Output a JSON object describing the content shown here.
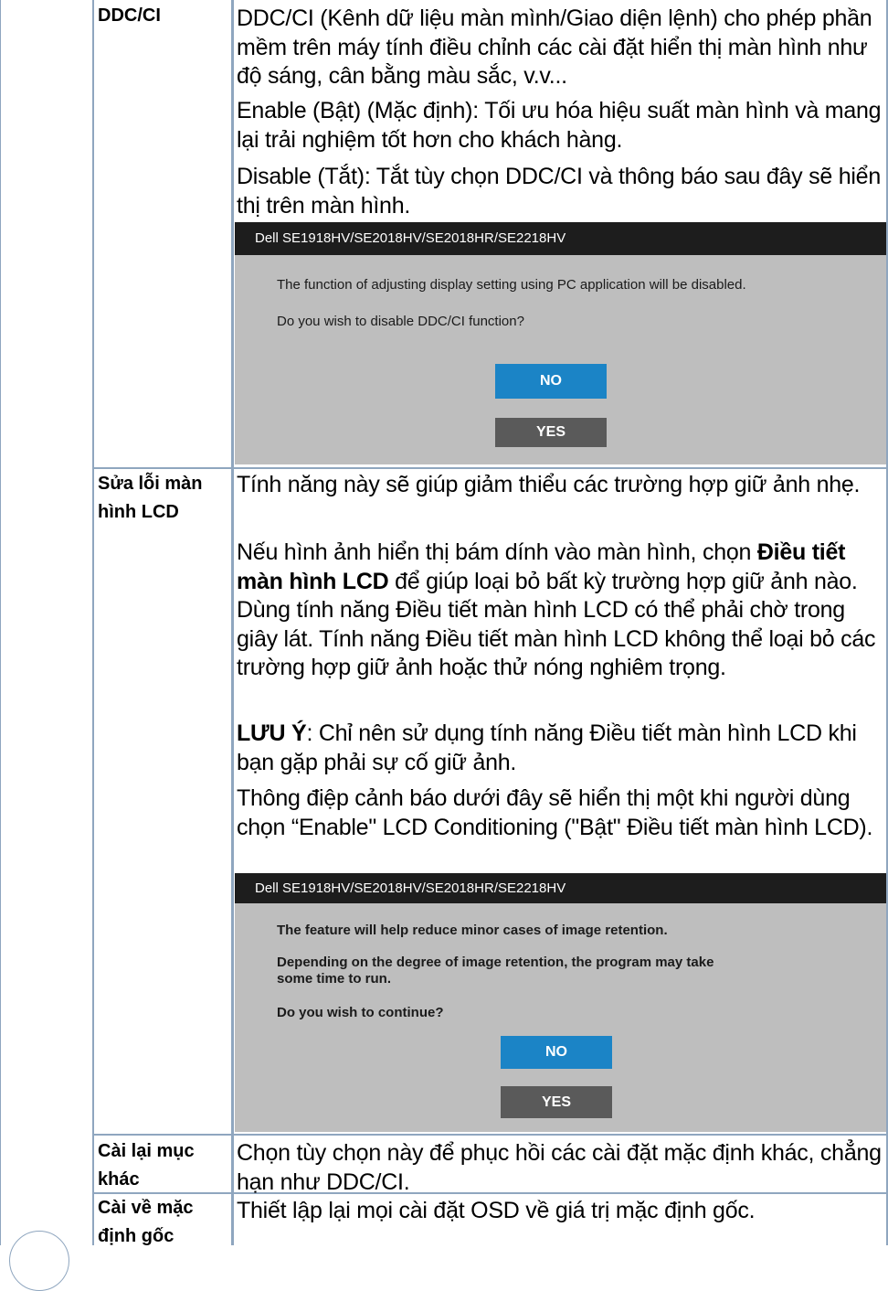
{
  "rows": [
    {
      "label": "DDC/CI",
      "paragraphs": [
        "DDC/CI (Kênh dữ liệu màn mình/Giao diện lệnh) cho phép phần mềm trên máy tính điều chỉnh các cài đặt hiển thị màn hình như độ sáng, cân bằng màu sắc, v.v...",
        "Enable (Bật) (Mặc định): Tối ưu hóa hiệu suất màn hình và mang lại trải nghiệm tốt hơn cho khách hàng.",
        "Disable (Tắt): Tắt tùy chọn DDC/CI và thông báo sau đây sẽ hiển thị trên màn hình."
      ],
      "dialog": {
        "title": "Dell SE1918HV/SE2018HV/SE2018HR/SE2218HV",
        "lines": [
          "The function of adjusting display setting using PC application will be disabled.",
          "Do you wish to disable DDC/CI function?"
        ],
        "no_label": "NO",
        "yes_label": "YES"
      }
    },
    {
      "label": "Sửa lỗi màn hình LCD",
      "p1": "Tính năng này sẽ giúp giảm thiểu các trường hợp giữ ảnh nhẹ.",
      "p2_before": "Nếu hình ảnh hiển thị bám dính vào màn hình, chọn ",
      "p2_bold": "Điều tiết màn hình LCD",
      "p2_after": " để giúp loại bỏ bất kỳ trường hợp giữ ảnh nào. Dùng tính năng Điều tiết màn hình LCD có thể phải chờ trong giây lát. Tính năng Điều tiết màn hình LCD không thể loại bỏ các trường hợp giữ ảnh hoặc thử nóng nghiêm trọng.",
      "note_bold": "LƯU Ý",
      "note_text": ": Chỉ nên sử dụng tính năng Điều tiết màn hình LCD khi bạn gặp phải sự cố giữ ảnh.",
      "p4": "Thông điệp cảnh báo dưới đây sẽ hiển thị một khi người dùng chọn “Enable\" LCD Conditioning (\"Bật\" Điều tiết màn hình LCD).",
      "dialog": {
        "title": "Dell SE1918HV/SE2018HV/SE2018HR/SE2218HV",
        "lines": [
          "The feature will help reduce minor cases of image retention.",
          "Depending on the degree of image retention, the program may take",
          "some time to run.",
          "Do you wish to continue?"
        ],
        "no_label": "NO",
        "yes_label": "YES"
      }
    },
    {
      "label": "Cài lại mục khác",
      "text": "Chọn tùy chọn này để phục hồi các cài đặt mặc định khác, chẳng hạn như DDC/CI."
    },
    {
      "label": "Cài về mặc định gốc",
      "text": "Thiết lập lại mọi cài đặt OSD về giá trị mặc định gốc."
    }
  ]
}
